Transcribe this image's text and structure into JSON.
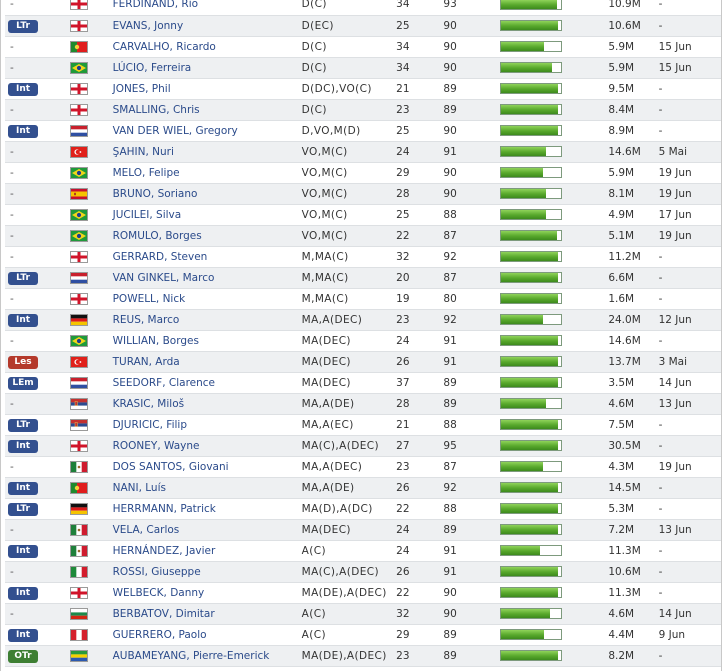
{
  "players": [
    {
      "status": "-",
      "badge_color": "",
      "flag": "england",
      "name": "FERDINAND, Rio",
      "position": "D(C)",
      "age": "34",
      "rating": "93",
      "fitness": 0.93,
      "value": "10.9M",
      "date": "-"
    },
    {
      "status": "LTr",
      "badge_color": "blue",
      "flag": "england",
      "name": "EVANS, Jonny",
      "position": "D(EC)",
      "age": "25",
      "rating": "90",
      "fitness": 0.95,
      "value": "10.6M",
      "date": "-"
    },
    {
      "status": "-",
      "badge_color": "",
      "flag": "portugal",
      "name": "CARVALHO, Ricardo",
      "position": "D(C)",
      "age": "34",
      "rating": "90",
      "fitness": 0.72,
      "value": "5.9M",
      "date": "15 Jun"
    },
    {
      "status": "-",
      "badge_color": "",
      "flag": "brazil",
      "name": "LÚCIO, Ferreira",
      "position": "D(C)",
      "age": "34",
      "rating": "90",
      "fitness": 0.86,
      "value": "5.9M",
      "date": "15 Jun"
    },
    {
      "status": "Int",
      "badge_color": "blue",
      "flag": "england",
      "name": "JONES, Phil",
      "position": "D(DC),VO(C)",
      "age": "21",
      "rating": "89",
      "fitness": 0.95,
      "value": "9.5M",
      "date": "-"
    },
    {
      "status": "-",
      "badge_color": "",
      "flag": "england",
      "name": "SMALLING, Chris",
      "position": "D(C)",
      "age": "23",
      "rating": "89",
      "fitness": 0.95,
      "value": "8.4M",
      "date": "-"
    },
    {
      "status": "Int",
      "badge_color": "blue",
      "flag": "netherlands",
      "name": "VAN DER WIEL, Gregory",
      "position": "D,VO,M(D)",
      "age": "25",
      "rating": "90",
      "fitness": 0.95,
      "value": "8.9M",
      "date": "-"
    },
    {
      "status": "-",
      "badge_color": "",
      "flag": "turkey",
      "name": "ŞAHIN, Nuri",
      "position": "VO,M(C)",
      "age": "24",
      "rating": "91",
      "fitness": 0.75,
      "value": "14.6M",
      "date": "5 Mai"
    },
    {
      "status": "-",
      "badge_color": "",
      "flag": "brazil",
      "name": "MELO, Felipe",
      "position": "VO,M(C)",
      "age": "29",
      "rating": "90",
      "fitness": 0.7,
      "value": "5.9M",
      "date": "19 Jun"
    },
    {
      "status": "-",
      "badge_color": "",
      "flag": "spain",
      "name": "BRUNO, Soriano",
      "position": "VO,M(C)",
      "age": "28",
      "rating": "90",
      "fitness": 0.75,
      "value": "8.1M",
      "date": "19 Jun"
    },
    {
      "status": "-",
      "badge_color": "",
      "flag": "brazil",
      "name": "JUCILEI, Silva",
      "position": "VO,M(C)",
      "age": "25",
      "rating": "88",
      "fitness": 0.75,
      "value": "4.9M",
      "date": "17 Jun"
    },
    {
      "status": "-",
      "badge_color": "",
      "flag": "brazil",
      "name": "ROMULO, Borges",
      "position": "VO,M(C)",
      "age": "22",
      "rating": "87",
      "fitness": 0.93,
      "value": "5.1M",
      "date": "19 Jun"
    },
    {
      "status": "-",
      "badge_color": "",
      "flag": "england",
      "name": "GERRARD, Steven",
      "position": "M,MA(C)",
      "age": "32",
      "rating": "92",
      "fitness": 0.95,
      "value": "11.2M",
      "date": "-"
    },
    {
      "status": "LTr",
      "badge_color": "blue",
      "flag": "netherlands",
      "name": "VAN GINKEL, Marco",
      "position": "M,MA(C)",
      "age": "20",
      "rating": "87",
      "fitness": 0.95,
      "value": "6.6M",
      "date": "-"
    },
    {
      "status": "-",
      "badge_color": "",
      "flag": "england",
      "name": "POWELL, Nick",
      "position": "M,MA(C)",
      "age": "19",
      "rating": "80",
      "fitness": 0.95,
      "value": "1.6M",
      "date": "-"
    },
    {
      "status": "Int",
      "badge_color": "blue",
      "flag": "germany",
      "name": "REUS, Marco",
      "position": "MA,A(DEC)",
      "age": "23",
      "rating": "92",
      "fitness": 0.7,
      "value": "24.0M",
      "date": "12 Jun"
    },
    {
      "status": "-",
      "badge_color": "",
      "flag": "brazil",
      "name": "WILLIAN, Borges",
      "position": "MA(DEC)",
      "age": "24",
      "rating": "91",
      "fitness": 0.95,
      "value": "14.6M",
      "date": "-"
    },
    {
      "status": "Les",
      "badge_color": "red",
      "flag": "turkey",
      "name": "TURAN, Arda",
      "position": "MA(DEC)",
      "age": "26",
      "rating": "91",
      "fitness": 0.95,
      "value": "13.7M",
      "date": "3 Mai"
    },
    {
      "status": "LEm",
      "badge_color": "blue",
      "flag": "netherlands",
      "name": "SEEDORF, Clarence",
      "position": "MA(DEC)",
      "age": "37",
      "rating": "89",
      "fitness": 0.95,
      "value": "3.5M",
      "date": "14 Jun"
    },
    {
      "status": "-",
      "badge_color": "",
      "flag": "serbia",
      "name": "KRASIC, Miloš",
      "position": "MA,A(DE)",
      "age": "28",
      "rating": "89",
      "fitness": 0.75,
      "value": "4.6M",
      "date": "13 Jun"
    },
    {
      "status": "LTr",
      "badge_color": "blue",
      "flag": "serbia",
      "name": "DJURICIC, Filip",
      "position": "MA,A(EC)",
      "age": "21",
      "rating": "88",
      "fitness": 0.95,
      "value": "7.5M",
      "date": "-"
    },
    {
      "status": "Int",
      "badge_color": "blue",
      "flag": "england",
      "name": "ROONEY, Wayne",
      "position": "MA(C),A(DEC)",
      "age": "27",
      "rating": "95",
      "fitness": 0.95,
      "value": "30.5M",
      "date": "-"
    },
    {
      "status": "-",
      "badge_color": "",
      "flag": "mexico",
      "name": "DOS SANTOS, Giovani",
      "position": "MA,A(DEC)",
      "age": "23",
      "rating": "87",
      "fitness": 0.7,
      "value": "4.3M",
      "date": "19 Jun"
    },
    {
      "status": "Int",
      "badge_color": "blue",
      "flag": "portugal",
      "name": "NANI, Luís",
      "position": "MA,A(DE)",
      "age": "26",
      "rating": "92",
      "fitness": 0.95,
      "value": "14.5M",
      "date": "-"
    },
    {
      "status": "LTr",
      "badge_color": "blue",
      "flag": "germany",
      "name": "HERRMANN, Patrick",
      "position": "MA(D),A(DC)",
      "age": "22",
      "rating": "88",
      "fitness": 0.95,
      "value": "5.3M",
      "date": "-"
    },
    {
      "status": "-",
      "badge_color": "",
      "flag": "mexico",
      "name": "VELA, Carlos",
      "position": "MA(DEC)",
      "age": "24",
      "rating": "89",
      "fitness": 0.95,
      "value": "7.2M",
      "date": "13 Jun"
    },
    {
      "status": "Int",
      "badge_color": "blue",
      "flag": "mexico",
      "name": "HERNÁNDEZ, Javier",
      "position": "A(C)",
      "age": "24",
      "rating": "91",
      "fitness": 0.65,
      "value": "11.3M",
      "date": "-"
    },
    {
      "status": "-",
      "badge_color": "",
      "flag": "italy",
      "name": "ROSSI, Giuseppe",
      "position": "MA(C),A(DEC)",
      "age": "26",
      "rating": "91",
      "fitness": 0.95,
      "value": "10.6M",
      "date": "-"
    },
    {
      "status": "Int",
      "badge_color": "blue",
      "flag": "england",
      "name": "WELBECK, Danny",
      "position": "MA(DE),A(DEC)",
      "age": "22",
      "rating": "90",
      "fitness": 0.95,
      "value": "11.3M",
      "date": "-"
    },
    {
      "status": "-",
      "badge_color": "",
      "flag": "bulgaria",
      "name": "BERBATOV, Dimitar",
      "position": "A(C)",
      "age": "32",
      "rating": "90",
      "fitness": 0.82,
      "value": "4.6M",
      "date": "14 Jun"
    },
    {
      "status": "Int",
      "badge_color": "blue",
      "flag": "peru",
      "name": "GUERRERO, Paolo",
      "position": "A(C)",
      "age": "29",
      "rating": "89",
      "fitness": 0.72,
      "value": "4.4M",
      "date": "9 Jun"
    },
    {
      "status": "OTr",
      "badge_color": "green",
      "flag": "gabon",
      "name": "AUBAMEYANG, Pierre-Emerick",
      "position": "MA(DE),A(DEC)",
      "age": "23",
      "rating": "89",
      "fitness": 0.95,
      "value": "8.2M",
      "date": "-"
    }
  ]
}
